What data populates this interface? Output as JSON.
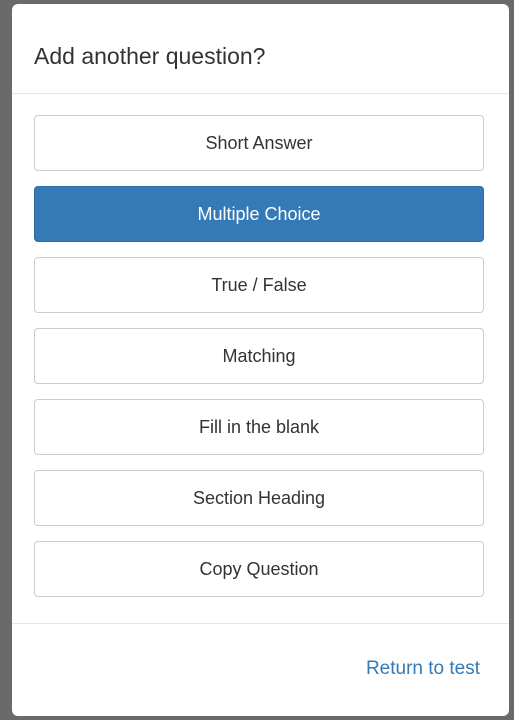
{
  "modal": {
    "title": "Add another question?",
    "options": [
      {
        "label": "Short Answer",
        "selected": false
      },
      {
        "label": "Multiple Choice",
        "selected": true
      },
      {
        "label": "True / False",
        "selected": false
      },
      {
        "label": "Matching",
        "selected": false
      },
      {
        "label": "Fill in the blank",
        "selected": false
      },
      {
        "label": "Section Heading",
        "selected": false
      },
      {
        "label": "Copy Question",
        "selected": false
      }
    ],
    "footer": {
      "return_label": "Return to test"
    }
  },
  "colors": {
    "accent": "#337ab7",
    "backdrop": "#6a6a6a"
  }
}
